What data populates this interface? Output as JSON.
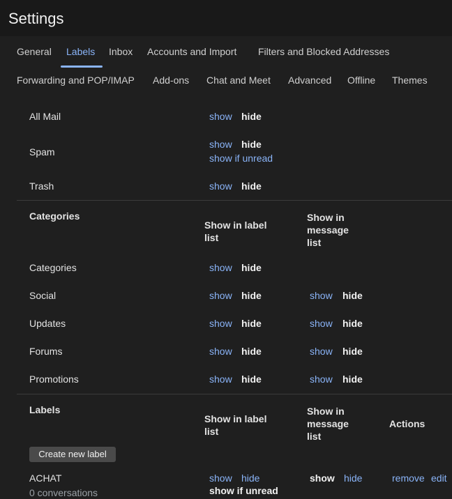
{
  "header": {
    "title": "Settings"
  },
  "tabs": [
    "General",
    "Labels",
    "Inbox",
    "Accounts and Import",
    "Filters and Blocked Addresses",
    "Forwarding and POP/IMAP",
    "Add-ons",
    "Chat and Meet",
    "Advanced",
    "Offline",
    "Themes"
  ],
  "active_tab": "Labels",
  "system_labels": [
    {
      "name": "All Mail",
      "show": "show",
      "hide": "hide"
    },
    {
      "name": "Spam",
      "show": "show",
      "hide": "hide",
      "show_if_unread": "show if unread"
    },
    {
      "name": "Trash",
      "show": "show",
      "hide": "hide"
    }
  ],
  "categories": {
    "heading": "Categories",
    "col_label_list": "Show in label list",
    "col_message_list": "Show in message list",
    "rows": [
      {
        "name": "Categories",
        "label_show": "show",
        "label_hide": "hide"
      },
      {
        "name": "Social",
        "label_show": "show",
        "label_hide": "hide",
        "msg_show": "show",
        "msg_hide": "hide"
      },
      {
        "name": "Updates",
        "label_show": "show",
        "label_hide": "hide",
        "msg_show": "show",
        "msg_hide": "hide"
      },
      {
        "name": "Forums",
        "label_show": "show",
        "label_hide": "hide",
        "msg_show": "show",
        "msg_hide": "hide"
      },
      {
        "name": "Promotions",
        "label_show": "show",
        "label_hide": "hide",
        "msg_show": "show",
        "msg_hide": "hide"
      }
    ]
  },
  "labels": {
    "heading": "Labels",
    "col_label_list": "Show in label list",
    "col_message_list": "Show in message list",
    "col_actions": "Actions",
    "create_button": "Create new label",
    "rows": [
      {
        "name": "ACHAT",
        "count": "0 conversations",
        "label_show": "show",
        "label_hide": "hide",
        "label_show_if_unread": "show if unread",
        "msg_show": "show",
        "msg_hide": "hide",
        "remove": "remove",
        "edit": "edit"
      }
    ]
  }
}
